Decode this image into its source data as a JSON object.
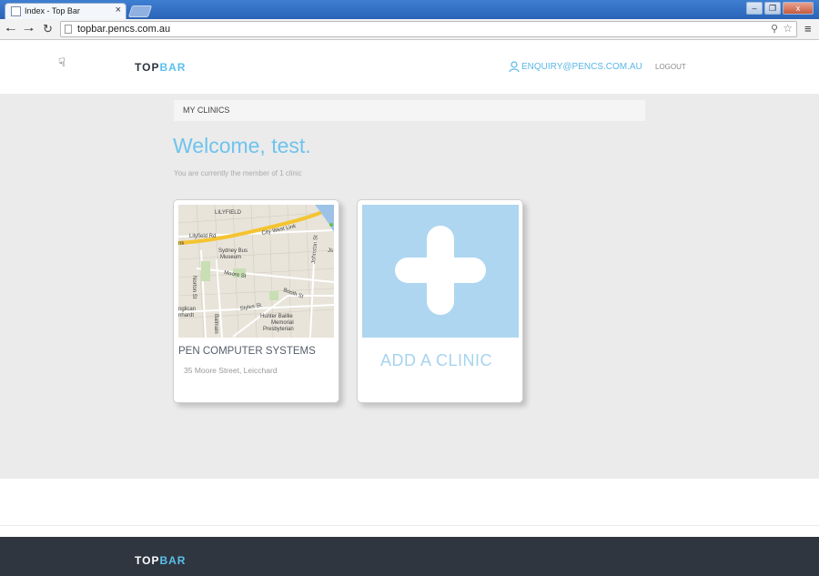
{
  "browser": {
    "tab_title": "Index - Top Bar",
    "tab_close": "×",
    "url": "topbar.pencs.com.au",
    "win_min": "–",
    "win_restore": "❐",
    "win_close": "x"
  },
  "header": {
    "brand_part1": "TOP",
    "brand_part2": "BAR",
    "enquiry_email": "ENQUIRY@PENCS.COM.AU",
    "logout_label": "LOGOUT"
  },
  "main": {
    "breadcrumb": "MY CLINICS",
    "welcome": "Welcome, test.",
    "member_text": "You are currently the member of 1 clinic"
  },
  "clinics": [
    {
      "name": "PEN COMPUTER SYSTEMS",
      "address": "35 Moore Street, Leicchard",
      "map_labels": {
        "suburb": "LILYFIELD",
        "road1": "Lilyfield Rd",
        "road2": "City West Link",
        "museum1": "Sydney Bus",
        "museum2": "Museum",
        "moore": "Moore St",
        "norton": "Norton St",
        "booth": "Booth St",
        "johnston": "Johnston St",
        "styles": "Styles St",
        "hunter1": "Hunter Baillie",
        "hunter2": "Memorial",
        "hunter3": "Presbyterian",
        "anglican1": "nglican",
        "anglican2": "nhardt",
        "balmain": "Balmain",
        "nk": "nk",
        "js": "Js"
      }
    }
  ],
  "add_clinic": {
    "label": "ADD A CLINIC"
  },
  "footer": {
    "brand_part1": "TOP",
    "brand_part2": "BAR"
  },
  "colors": {
    "accent": "#5bc0eb",
    "welcome": "#6ec3ee",
    "add_tile": "#aed6f0",
    "footer_bg": "#2f3640"
  }
}
